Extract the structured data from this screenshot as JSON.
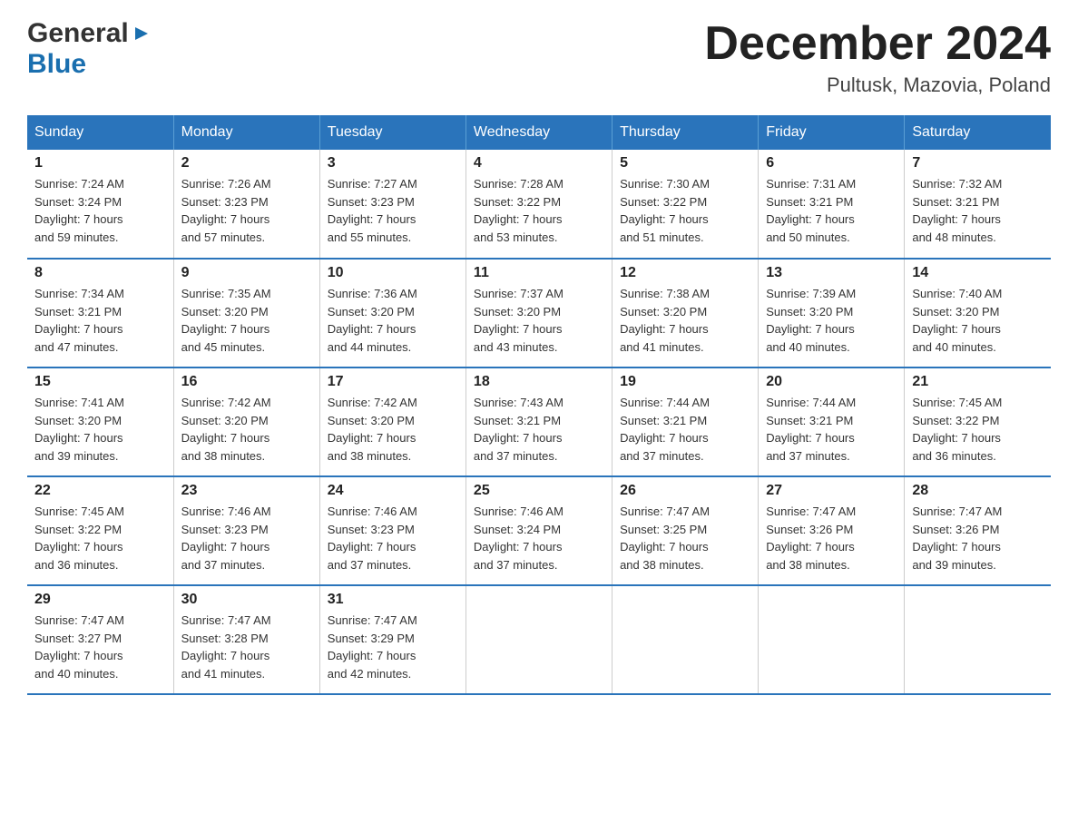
{
  "header": {
    "logo_general": "General",
    "logo_blue": "Blue",
    "title": "December 2024",
    "subtitle": "Pultusk, Mazovia, Poland"
  },
  "days_of_week": [
    "Sunday",
    "Monday",
    "Tuesday",
    "Wednesday",
    "Thursday",
    "Friday",
    "Saturday"
  ],
  "weeks": [
    [
      {
        "day": "1",
        "sunrise": "7:24 AM",
        "sunset": "3:24 PM",
        "daylight": "7 hours and 59 minutes."
      },
      {
        "day": "2",
        "sunrise": "7:26 AM",
        "sunset": "3:23 PM",
        "daylight": "7 hours and 57 minutes."
      },
      {
        "day": "3",
        "sunrise": "7:27 AM",
        "sunset": "3:23 PM",
        "daylight": "7 hours and 55 minutes."
      },
      {
        "day": "4",
        "sunrise": "7:28 AM",
        "sunset": "3:22 PM",
        "daylight": "7 hours and 53 minutes."
      },
      {
        "day": "5",
        "sunrise": "7:30 AM",
        "sunset": "3:22 PM",
        "daylight": "7 hours and 51 minutes."
      },
      {
        "day": "6",
        "sunrise": "7:31 AM",
        "sunset": "3:21 PM",
        "daylight": "7 hours and 50 minutes."
      },
      {
        "day": "7",
        "sunrise": "7:32 AM",
        "sunset": "3:21 PM",
        "daylight": "7 hours and 48 minutes."
      }
    ],
    [
      {
        "day": "8",
        "sunrise": "7:34 AM",
        "sunset": "3:21 PM",
        "daylight": "7 hours and 47 minutes."
      },
      {
        "day": "9",
        "sunrise": "7:35 AM",
        "sunset": "3:20 PM",
        "daylight": "7 hours and 45 minutes."
      },
      {
        "day": "10",
        "sunrise": "7:36 AM",
        "sunset": "3:20 PM",
        "daylight": "7 hours and 44 minutes."
      },
      {
        "day": "11",
        "sunrise": "7:37 AM",
        "sunset": "3:20 PM",
        "daylight": "7 hours and 43 minutes."
      },
      {
        "day": "12",
        "sunrise": "7:38 AM",
        "sunset": "3:20 PM",
        "daylight": "7 hours and 41 minutes."
      },
      {
        "day": "13",
        "sunrise": "7:39 AM",
        "sunset": "3:20 PM",
        "daylight": "7 hours and 40 minutes."
      },
      {
        "day": "14",
        "sunrise": "7:40 AM",
        "sunset": "3:20 PM",
        "daylight": "7 hours and 40 minutes."
      }
    ],
    [
      {
        "day": "15",
        "sunrise": "7:41 AM",
        "sunset": "3:20 PM",
        "daylight": "7 hours and 39 minutes."
      },
      {
        "day": "16",
        "sunrise": "7:42 AM",
        "sunset": "3:20 PM",
        "daylight": "7 hours and 38 minutes."
      },
      {
        "day": "17",
        "sunrise": "7:42 AM",
        "sunset": "3:20 PM",
        "daylight": "7 hours and 38 minutes."
      },
      {
        "day": "18",
        "sunrise": "7:43 AM",
        "sunset": "3:21 PM",
        "daylight": "7 hours and 37 minutes."
      },
      {
        "day": "19",
        "sunrise": "7:44 AM",
        "sunset": "3:21 PM",
        "daylight": "7 hours and 37 minutes."
      },
      {
        "day": "20",
        "sunrise": "7:44 AM",
        "sunset": "3:21 PM",
        "daylight": "7 hours and 37 minutes."
      },
      {
        "day": "21",
        "sunrise": "7:45 AM",
        "sunset": "3:22 PM",
        "daylight": "7 hours and 36 minutes."
      }
    ],
    [
      {
        "day": "22",
        "sunrise": "7:45 AM",
        "sunset": "3:22 PM",
        "daylight": "7 hours and 36 minutes."
      },
      {
        "day": "23",
        "sunrise": "7:46 AM",
        "sunset": "3:23 PM",
        "daylight": "7 hours and 37 minutes."
      },
      {
        "day": "24",
        "sunrise": "7:46 AM",
        "sunset": "3:23 PM",
        "daylight": "7 hours and 37 minutes."
      },
      {
        "day": "25",
        "sunrise": "7:46 AM",
        "sunset": "3:24 PM",
        "daylight": "7 hours and 37 minutes."
      },
      {
        "day": "26",
        "sunrise": "7:47 AM",
        "sunset": "3:25 PM",
        "daylight": "7 hours and 38 minutes."
      },
      {
        "day": "27",
        "sunrise": "7:47 AM",
        "sunset": "3:26 PM",
        "daylight": "7 hours and 38 minutes."
      },
      {
        "day": "28",
        "sunrise": "7:47 AM",
        "sunset": "3:26 PM",
        "daylight": "7 hours and 39 minutes."
      }
    ],
    [
      {
        "day": "29",
        "sunrise": "7:47 AM",
        "sunset": "3:27 PM",
        "daylight": "7 hours and 40 minutes."
      },
      {
        "day": "30",
        "sunrise": "7:47 AM",
        "sunset": "3:28 PM",
        "daylight": "7 hours and 41 minutes."
      },
      {
        "day": "31",
        "sunrise": "7:47 AM",
        "sunset": "3:29 PM",
        "daylight": "7 hours and 42 minutes."
      },
      null,
      null,
      null,
      null
    ]
  ],
  "labels": {
    "sunrise": "Sunrise:",
    "sunset": "Sunset:",
    "daylight": "Daylight:"
  }
}
